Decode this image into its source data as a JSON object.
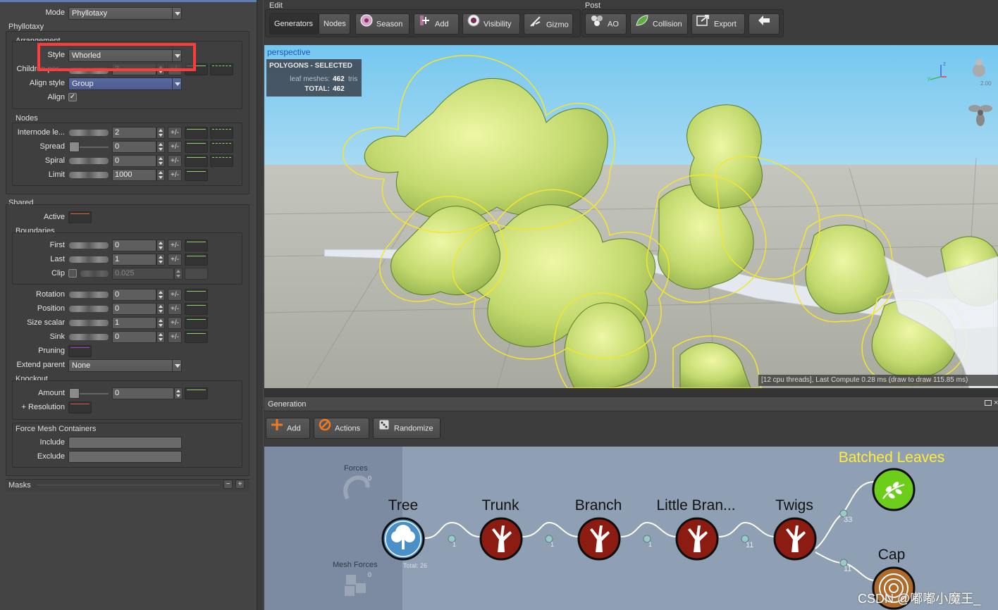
{
  "left": {
    "mode_label": "Mode",
    "mode_value": "Phyllotaxy",
    "phyllotaxy_title": "Phyllotaxy",
    "arrangement_title": "Arrangement",
    "style_label": "Style",
    "style_value": "Whorled",
    "children_label": "Children per...",
    "children_value": "3",
    "align_style_label": "Align style",
    "align_style_value": "Group",
    "align_label": "Align",
    "align_checked": "✓",
    "nodes_title": "Nodes",
    "internode_label": "Internode le...",
    "internode_value": "2",
    "spread_label": "Spread",
    "spread_value": "0",
    "spiral_label": "Spiral",
    "spiral_value": "0",
    "limit_label": "Limit",
    "limit_value": "1000",
    "pm": "+/-",
    "shared_title": "Shared",
    "active_label": "Active",
    "boundaries_title": "Boundaries",
    "first_label": "First",
    "first_value": "0",
    "last_label": "Last",
    "last_value": "1",
    "clip_label": "Clip",
    "clip_value": "0.025",
    "rotation_label": "Rotation",
    "rotation_value": "0",
    "position_label": "Position",
    "position_value": "0",
    "size_scalar_label": "Size scalar",
    "size_scalar_value": "1",
    "sink_label": "Sink",
    "sink_value": "0",
    "pruning_label": "Pruning",
    "extend_parent_label": "Extend parent",
    "extend_parent_value": "None",
    "knockout_title": "Knockout",
    "amount_label": "Amount",
    "amount_value": "0",
    "resolution_label": "+ Resolution",
    "force_mesh_title": "Force Mesh Containers",
    "include_label": "Include",
    "exclude_label": "Exclude",
    "masks_title": "Masks",
    "minus": "−",
    "plus": "+"
  },
  "toolbar": {
    "edit_title": "Edit",
    "post_title": "Post",
    "generators": "Generators",
    "nodes": "Nodes",
    "season": "Season",
    "add": "Add",
    "visibility": "Visibility",
    "gizmo": "Gizmo",
    "ao": "AO",
    "collision": "Collision",
    "export": "Export"
  },
  "viewport": {
    "view_name": "perspective",
    "poly_title": "POLYGONS - SELECTED",
    "leaf_label": "leaf meshes:",
    "leaf_value": "462",
    "leaf_unit": "tris",
    "total_label": "TOTAL:",
    "total_value": "462",
    "axis_z": "z",
    "axis_y": "y",
    "zoom": "2.00",
    "status": "[12 cpu threads], Last Compute 0.28 ms (draw to draw 115.85 ms)"
  },
  "generation": {
    "title": "Generation",
    "add": "Add",
    "actions": "Actions",
    "randomize": "Randomize",
    "forces_label": "Forces",
    "forces_count": "0",
    "mesh_forces_label": "Mesh Forces",
    "mesh_forces_count": "0",
    "total": "Total: 26",
    "nodes": {
      "tree": "Tree",
      "trunk": "Trunk",
      "branch": "Branch",
      "little": "Little Bran...",
      "twigs": "Twigs",
      "batched": "Batched Leaves",
      "cap": "Cap"
    },
    "counts": {
      "trunk": "1",
      "branch": "1",
      "little": "1",
      "twigs": "11",
      "batched": "33",
      "cap": "11"
    },
    "watermark": "CSDN @嘟嘟小魔王_"
  },
  "colors": {
    "selection_box": "#ff3b3b",
    "leaf_outline": "#f3e62e",
    "batched_leaves_label": "#ffee33",
    "tree_node": "#4a90c8",
    "branch_node": "#8c1b12",
    "leaves_node": "#6ccd1a"
  }
}
